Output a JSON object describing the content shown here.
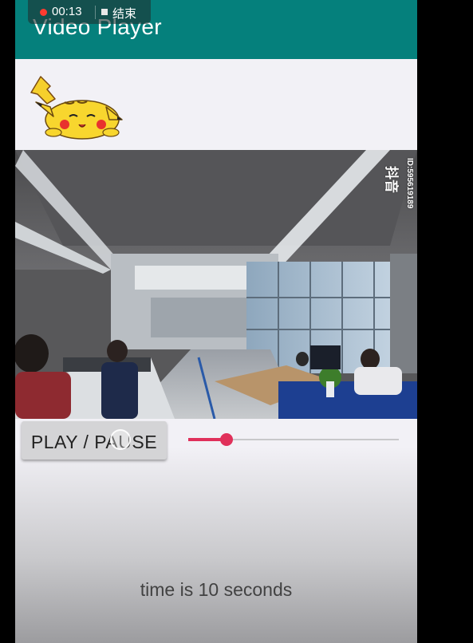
{
  "recording": {
    "time": "00:13",
    "end_label": "结束"
  },
  "appbar": {
    "title": "Video Player"
  },
  "video": {
    "watermark_brand": "抖音",
    "watermark_id": "ID:59561918​9"
  },
  "controls": {
    "play_pause_label": "PLAY / PAUSE",
    "seek_progress": 0.18
  },
  "status": {
    "time_text": "time is 10 seconds"
  },
  "colors": {
    "appbar": "#05807c",
    "accent": "#e0305a"
  }
}
